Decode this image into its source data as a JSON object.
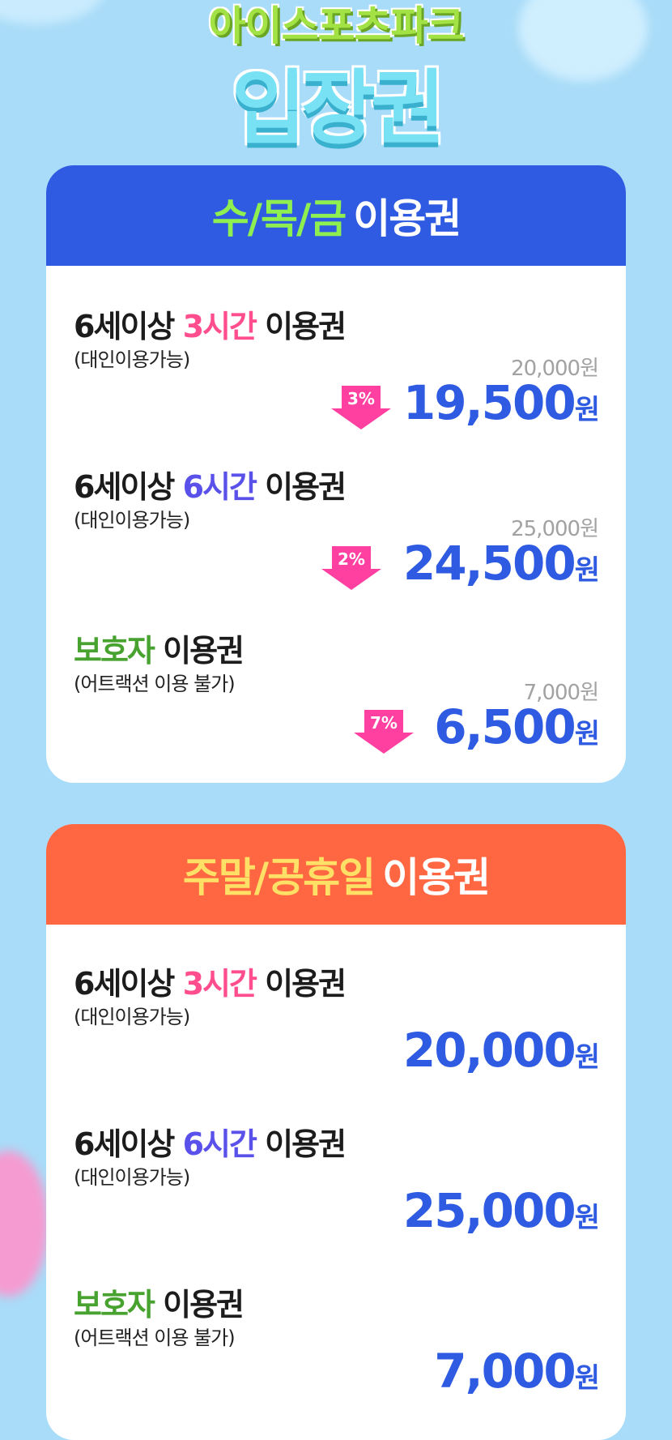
{
  "logo": {
    "top": "아이스포츠파크",
    "main": "입장권"
  },
  "weekday": {
    "title_accent": "수/목/금",
    "title_white": "이용권",
    "items": [
      {
        "n1": "6세이상 ",
        "n2": "3시간",
        "n3": " 이용권",
        "sub": "(대인이용가능)",
        "orig": "20,000원",
        "pct": "3%",
        "price": "19,500",
        "unit": "원"
      },
      {
        "n1": "6세이상 ",
        "n2": "6시간",
        "n3": " 이용권",
        "sub": "(대인이용가능)",
        "orig": "25,000원",
        "pct": "2%",
        "price": "24,500",
        "unit": "원"
      },
      {
        "n1": "보호자",
        "n2": " 이용권",
        "sub": "(어트랙션 이용 불가)",
        "orig": "7,000원",
        "pct": "7%",
        "price": "6,500",
        "unit": "원"
      }
    ]
  },
  "weekend": {
    "title_accent": "주말/공휴일",
    "title_white": "이용권",
    "items": [
      {
        "n1": "6세이상 ",
        "n2": "3시간",
        "n3": " 이용권",
        "sub": "(대인이용가능)",
        "price": "20,000",
        "unit": "원"
      },
      {
        "n1": "6세이상 ",
        "n2": "6시간",
        "n3": " 이용권",
        "sub": "(대인이용가능)",
        "price": "25,000",
        "unit": "원"
      },
      {
        "n1": "보호자",
        "n2": " 이용권",
        "sub": "(어트랙션 이용 불가)",
        "price": "7,000",
        "unit": "원"
      }
    ]
  }
}
